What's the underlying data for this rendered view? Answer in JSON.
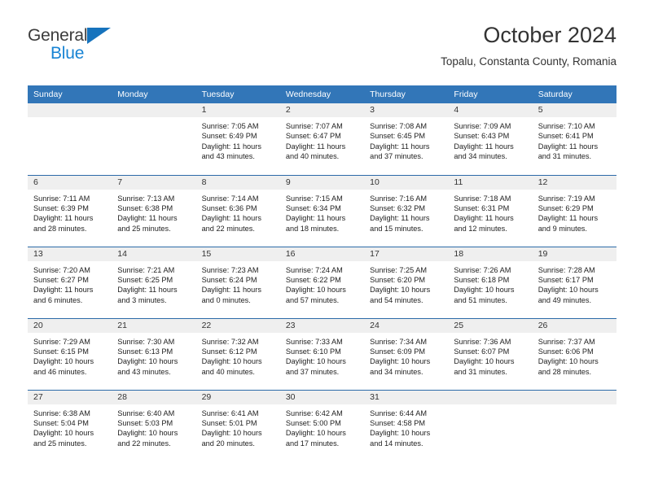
{
  "brand": {
    "name_part1": "General",
    "name_part2": "Blue",
    "accent_color": "#1884d4",
    "triangle_color": "#1673bd"
  },
  "header": {
    "title": "October 2024",
    "location": "Topalu, Constanta County, Romania"
  },
  "theme": {
    "header_row_bg": "#3276b8",
    "row_divider": "#2c6aa8",
    "daynum_bg": "#efefef"
  },
  "weekday_headers": [
    "Sunday",
    "Monday",
    "Tuesday",
    "Wednesday",
    "Thursday",
    "Friday",
    "Saturday"
  ],
  "labels": {
    "sunrise_prefix": "Sunrise:",
    "sunset_prefix": "Sunset:",
    "daylight_prefix": "Daylight:"
  },
  "weeks": [
    [
      {
        "day": "",
        "empty": true
      },
      {
        "day": "",
        "empty": true
      },
      {
        "day": "1",
        "sunrise": "Sunrise: 7:05 AM",
        "sunset": "Sunset: 6:49 PM",
        "daylight": "Daylight: 11 hours and 43 minutes."
      },
      {
        "day": "2",
        "sunrise": "Sunrise: 7:07 AM",
        "sunset": "Sunset: 6:47 PM",
        "daylight": "Daylight: 11 hours and 40 minutes."
      },
      {
        "day": "3",
        "sunrise": "Sunrise: 7:08 AM",
        "sunset": "Sunset: 6:45 PM",
        "daylight": "Daylight: 11 hours and 37 minutes."
      },
      {
        "day": "4",
        "sunrise": "Sunrise: 7:09 AM",
        "sunset": "Sunset: 6:43 PM",
        "daylight": "Daylight: 11 hours and 34 minutes."
      },
      {
        "day": "5",
        "sunrise": "Sunrise: 7:10 AM",
        "sunset": "Sunset: 6:41 PM",
        "daylight": "Daylight: 11 hours and 31 minutes."
      }
    ],
    [
      {
        "day": "6",
        "sunrise": "Sunrise: 7:11 AM",
        "sunset": "Sunset: 6:39 PM",
        "daylight": "Daylight: 11 hours and 28 minutes."
      },
      {
        "day": "7",
        "sunrise": "Sunrise: 7:13 AM",
        "sunset": "Sunset: 6:38 PM",
        "daylight": "Daylight: 11 hours and 25 minutes."
      },
      {
        "day": "8",
        "sunrise": "Sunrise: 7:14 AM",
        "sunset": "Sunset: 6:36 PM",
        "daylight": "Daylight: 11 hours and 22 minutes."
      },
      {
        "day": "9",
        "sunrise": "Sunrise: 7:15 AM",
        "sunset": "Sunset: 6:34 PM",
        "daylight": "Daylight: 11 hours and 18 minutes."
      },
      {
        "day": "10",
        "sunrise": "Sunrise: 7:16 AM",
        "sunset": "Sunset: 6:32 PM",
        "daylight": "Daylight: 11 hours and 15 minutes."
      },
      {
        "day": "11",
        "sunrise": "Sunrise: 7:18 AM",
        "sunset": "Sunset: 6:31 PM",
        "daylight": "Daylight: 11 hours and 12 minutes."
      },
      {
        "day": "12",
        "sunrise": "Sunrise: 7:19 AM",
        "sunset": "Sunset: 6:29 PM",
        "daylight": "Daylight: 11 hours and 9 minutes."
      }
    ],
    [
      {
        "day": "13",
        "sunrise": "Sunrise: 7:20 AM",
        "sunset": "Sunset: 6:27 PM",
        "daylight": "Daylight: 11 hours and 6 minutes."
      },
      {
        "day": "14",
        "sunrise": "Sunrise: 7:21 AM",
        "sunset": "Sunset: 6:25 PM",
        "daylight": "Daylight: 11 hours and 3 minutes."
      },
      {
        "day": "15",
        "sunrise": "Sunrise: 7:23 AM",
        "sunset": "Sunset: 6:24 PM",
        "daylight": "Daylight: 11 hours and 0 minutes."
      },
      {
        "day": "16",
        "sunrise": "Sunrise: 7:24 AM",
        "sunset": "Sunset: 6:22 PM",
        "daylight": "Daylight: 10 hours and 57 minutes."
      },
      {
        "day": "17",
        "sunrise": "Sunrise: 7:25 AM",
        "sunset": "Sunset: 6:20 PM",
        "daylight": "Daylight: 10 hours and 54 minutes."
      },
      {
        "day": "18",
        "sunrise": "Sunrise: 7:26 AM",
        "sunset": "Sunset: 6:18 PM",
        "daylight": "Daylight: 10 hours and 51 minutes."
      },
      {
        "day": "19",
        "sunrise": "Sunrise: 7:28 AM",
        "sunset": "Sunset: 6:17 PM",
        "daylight": "Daylight: 10 hours and 49 minutes."
      }
    ],
    [
      {
        "day": "20",
        "sunrise": "Sunrise: 7:29 AM",
        "sunset": "Sunset: 6:15 PM",
        "daylight": "Daylight: 10 hours and 46 minutes."
      },
      {
        "day": "21",
        "sunrise": "Sunrise: 7:30 AM",
        "sunset": "Sunset: 6:13 PM",
        "daylight": "Daylight: 10 hours and 43 minutes."
      },
      {
        "day": "22",
        "sunrise": "Sunrise: 7:32 AM",
        "sunset": "Sunset: 6:12 PM",
        "daylight": "Daylight: 10 hours and 40 minutes."
      },
      {
        "day": "23",
        "sunrise": "Sunrise: 7:33 AM",
        "sunset": "Sunset: 6:10 PM",
        "daylight": "Daylight: 10 hours and 37 minutes."
      },
      {
        "day": "24",
        "sunrise": "Sunrise: 7:34 AM",
        "sunset": "Sunset: 6:09 PM",
        "daylight": "Daylight: 10 hours and 34 minutes."
      },
      {
        "day": "25",
        "sunrise": "Sunrise: 7:36 AM",
        "sunset": "Sunset: 6:07 PM",
        "daylight": "Daylight: 10 hours and 31 minutes."
      },
      {
        "day": "26",
        "sunrise": "Sunrise: 7:37 AM",
        "sunset": "Sunset: 6:06 PM",
        "daylight": "Daylight: 10 hours and 28 minutes."
      }
    ],
    [
      {
        "day": "27",
        "sunrise": "Sunrise: 6:38 AM",
        "sunset": "Sunset: 5:04 PM",
        "daylight": "Daylight: 10 hours and 25 minutes."
      },
      {
        "day": "28",
        "sunrise": "Sunrise: 6:40 AM",
        "sunset": "Sunset: 5:03 PM",
        "daylight": "Daylight: 10 hours and 22 minutes."
      },
      {
        "day": "29",
        "sunrise": "Sunrise: 6:41 AM",
        "sunset": "Sunset: 5:01 PM",
        "daylight": "Daylight: 10 hours and 20 minutes."
      },
      {
        "day": "30",
        "sunrise": "Sunrise: 6:42 AM",
        "sunset": "Sunset: 5:00 PM",
        "daylight": "Daylight: 10 hours and 17 minutes."
      },
      {
        "day": "31",
        "sunrise": "Sunrise: 6:44 AM",
        "sunset": "Sunset: 4:58 PM",
        "daylight": "Daylight: 10 hours and 14 minutes."
      },
      {
        "day": "",
        "empty": true
      },
      {
        "day": "",
        "empty": true
      }
    ]
  ]
}
